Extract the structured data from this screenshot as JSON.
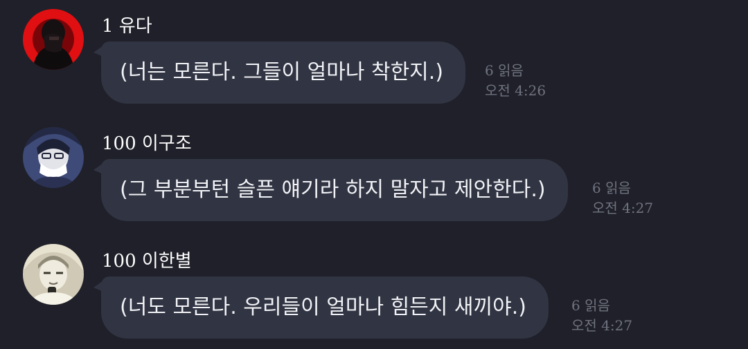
{
  "messages": [
    {
      "sender": "1 유다",
      "text": "(너는 모른다. 그들이 얼마나 착한지.)",
      "read": "6 읽음",
      "time": "오전 4:26",
      "avatar": "avatar-dark-red-figure"
    },
    {
      "sender": "100 이구조",
      "text": "(그 부분부턴 슬픈 얘기라 하지 말자고 제안한다.)",
      "read": "6 읽음",
      "time": "오전 4:27",
      "avatar": "avatar-blue-glasses-figure"
    },
    {
      "sender": "100 이한별",
      "text": "(너도 모른다. 우리들이 얼마나 힘든지 새끼야.)",
      "read": "6 읽음",
      "time": "오전 4:27",
      "avatar": "avatar-sketch-figure"
    }
  ],
  "colors": {
    "background": "#1f2029",
    "bubble": "#313442",
    "text": "#f2f3f7",
    "meta": "#70737f"
  }
}
